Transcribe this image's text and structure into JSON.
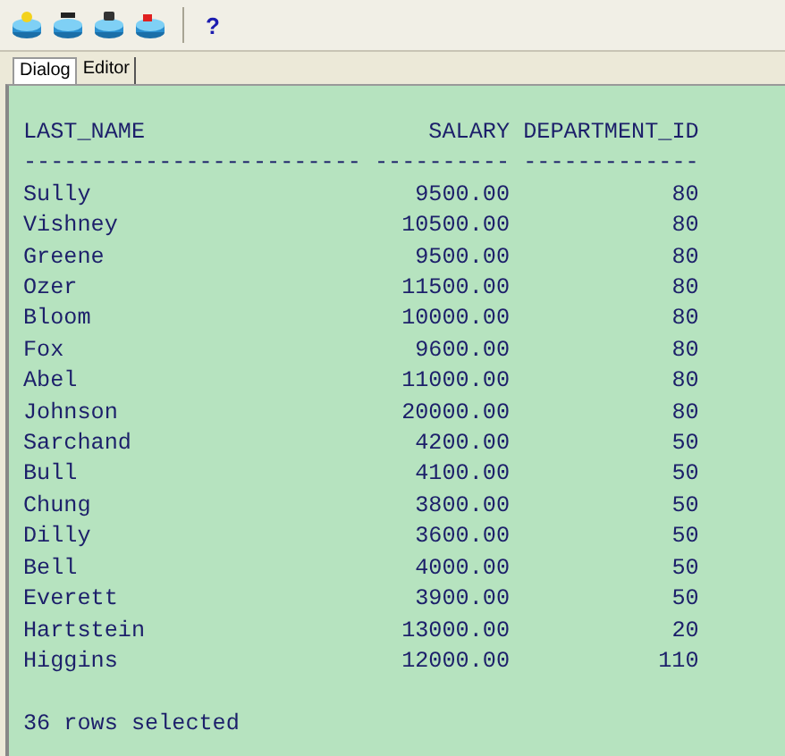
{
  "toolbar": {
    "help": "?"
  },
  "tabs": [
    {
      "label": "Dialog",
      "selected": true
    },
    {
      "label": "Editor",
      "selected": false
    }
  ],
  "output": {
    "columns": [
      "LAST_NAME",
      "SALARY",
      "DEPARTMENT_ID"
    ],
    "separators": [
      "-------------------------",
      "----------",
      "-------------"
    ],
    "rows": [
      {
        "last_name": "Sully",
        "salary": "9500.00",
        "department_id": "80"
      },
      {
        "last_name": "Vishney",
        "salary": "10500.00",
        "department_id": "80"
      },
      {
        "last_name": "Greene",
        "salary": "9500.00",
        "department_id": "80"
      },
      {
        "last_name": "Ozer",
        "salary": "11500.00",
        "department_id": "80"
      },
      {
        "last_name": "Bloom",
        "salary": "10000.00",
        "department_id": "80"
      },
      {
        "last_name": "Fox",
        "salary": "9600.00",
        "department_id": "80"
      },
      {
        "last_name": "Abel",
        "salary": "11000.00",
        "department_id": "80"
      },
      {
        "last_name": "Johnson",
        "salary": "20000.00",
        "department_id": "80"
      },
      {
        "last_name": "Sarchand",
        "salary": "4200.00",
        "department_id": "50"
      },
      {
        "last_name": "Bull",
        "salary": "4100.00",
        "department_id": "50"
      },
      {
        "last_name": "Chung",
        "salary": "3800.00",
        "department_id": "50"
      },
      {
        "last_name": "Dilly",
        "salary": "3600.00",
        "department_id": "50"
      },
      {
        "last_name": "Bell",
        "salary": "4000.00",
        "department_id": "50"
      },
      {
        "last_name": "Everett",
        "salary": "3900.00",
        "department_id": "50"
      },
      {
        "last_name": "Hartstein",
        "salary": "13000.00",
        "department_id": "20"
      },
      {
        "last_name": "Higgins",
        "salary": "12000.00",
        "department_id": "110"
      }
    ],
    "footer": "36 rows selected"
  }
}
